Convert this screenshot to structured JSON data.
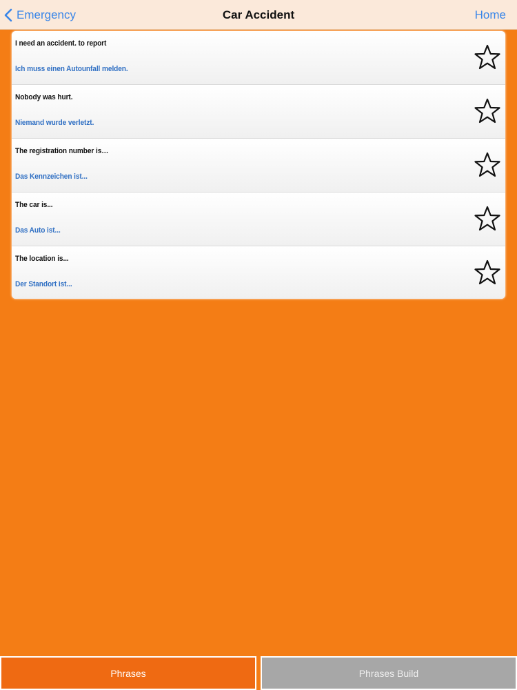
{
  "nav": {
    "back_label": "Emergency",
    "title": "Car Accident",
    "home_label": "Home"
  },
  "phrases": [
    {
      "en": "I need an accident. to report",
      "de": "Ich muss einen Autounfall melden.",
      "favorite": false
    },
    {
      "en": "Nobody was hurt.",
      "de": "Niemand wurde verletzt.",
      "favorite": false
    },
    {
      "en": "The registration number is…",
      "de": "Das Kennzeichen ist...",
      "favorite": false
    },
    {
      "en": "The car is...",
      "de": "Das Auto ist...",
      "favorite": false
    },
    {
      "en": "The location is...",
      "de": "Der Standort ist...",
      "favorite": false
    }
  ],
  "tabs": [
    {
      "label": "Phrases",
      "active": true
    },
    {
      "label": "Phrases Build",
      "active": false
    }
  ],
  "colors": {
    "background": "#f47d15",
    "nav_background": "#fbe9da",
    "link": "#3a86e8",
    "translation_text": "#2f6fc3",
    "active_tab": "#ef6a12",
    "inactive_tab": "#a7a7a7"
  },
  "icons": {
    "back": "chevron-left-icon",
    "favorite": "star-outline-icon"
  }
}
